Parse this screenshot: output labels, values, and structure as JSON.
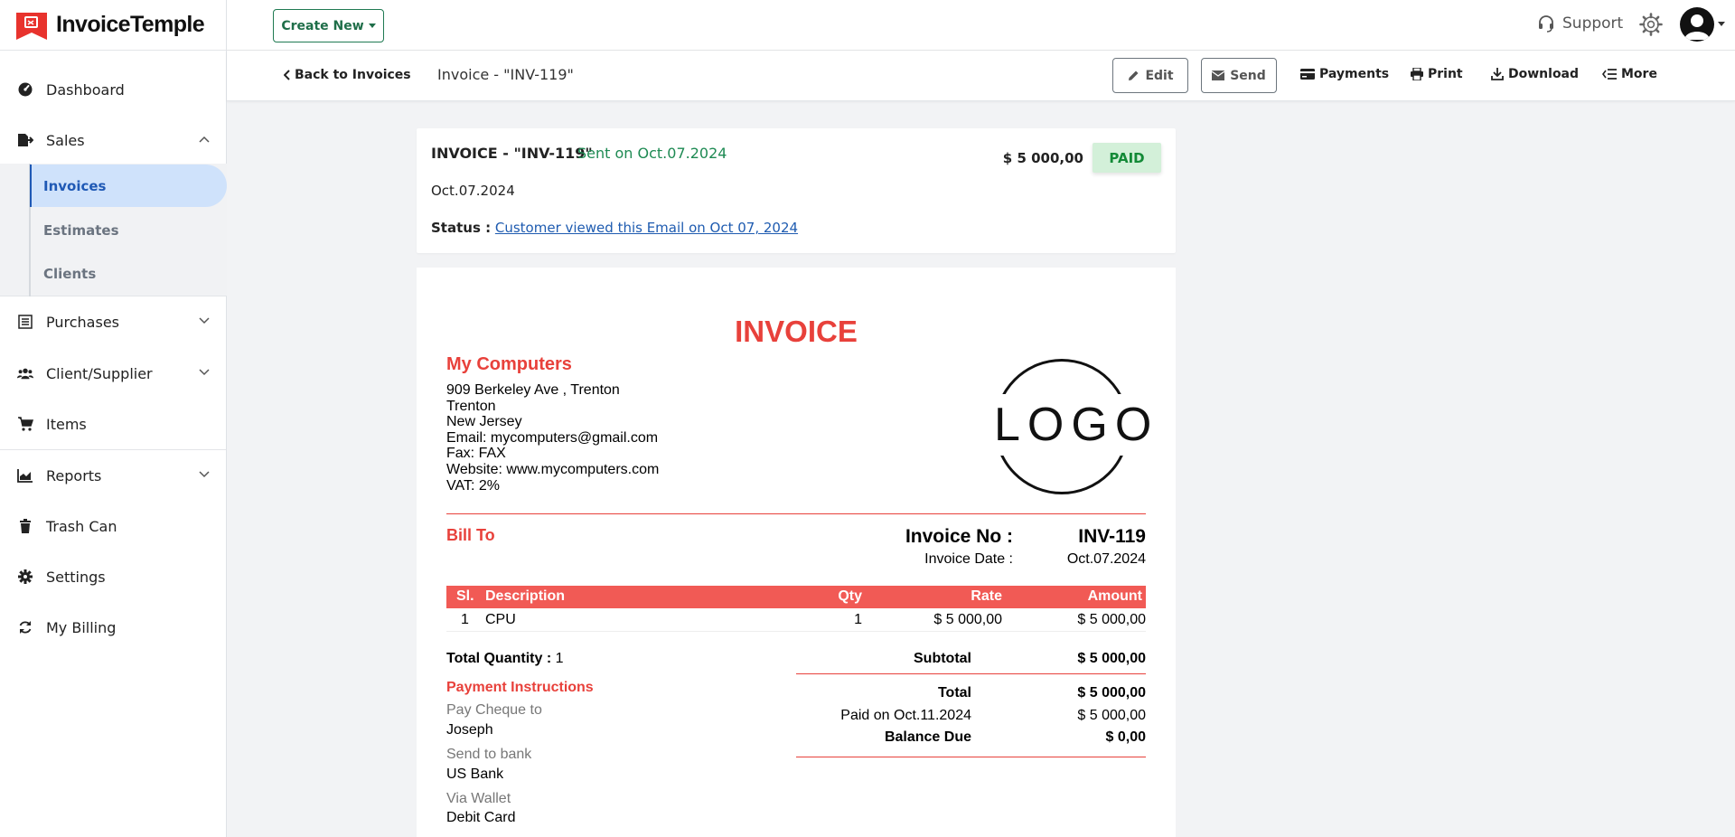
{
  "brand": {
    "name": "InvoiceTemple"
  },
  "sidebar": {
    "items": [
      {
        "label": "Dashboard",
        "icon": "dashboard-gauge-icon"
      },
      {
        "label": "Sales",
        "icon": "sales-file-icon",
        "expanded": true,
        "children": [
          {
            "label": "Invoices",
            "active": true
          },
          {
            "label": "Estimates"
          },
          {
            "label": "Clients"
          }
        ]
      },
      {
        "label": "Purchases",
        "icon": "purchases-list-icon"
      },
      {
        "label": "Client/Supplier",
        "icon": "users-icon"
      },
      {
        "label": "Items",
        "icon": "cart-icon"
      },
      {
        "label": "Reports",
        "icon": "chart-icon"
      },
      {
        "label": "Trash Can",
        "icon": "trash-icon"
      },
      {
        "label": "Settings",
        "icon": "gear-icon"
      },
      {
        "label": "My Billing",
        "icon": "refresh-icon"
      }
    ]
  },
  "topbar": {
    "create_new": "Create New",
    "support": "Support"
  },
  "subbar": {
    "back": "Back to Invoices",
    "title": "Invoice - \"INV-119\"",
    "actions": {
      "edit": "Edit",
      "send": "Send",
      "payments": "Payments",
      "print": "Print",
      "download": "Download",
      "more": "More"
    }
  },
  "summary": {
    "title": "INVOICE - \"INV-119\"",
    "sent": "Sent on Oct.07.2024",
    "amount": "$ 5 000,00",
    "badge": "PAID",
    "date": "Oct.07.2024",
    "status_label": "Status :",
    "status_text": "Customer viewed this Email on Oct 07, 2024"
  },
  "invoice": {
    "heading": "INVOICE",
    "company": {
      "name": "My Computers",
      "lines": [
        "909 Berkeley Ave , Trenton",
        "Trenton",
        "New Jersey",
        "Email: mycomputers@gmail.com",
        "Fax: FAX",
        "Website: www.mycomputers.com",
        "VAT: 2%"
      ]
    },
    "logo_text": "LOGO",
    "bill_to": "Bill To",
    "invoice_no_label": "Invoice No :",
    "invoice_no": "INV-119",
    "invoice_date_label": "Invoice Date :",
    "invoice_date": "Oct.07.2024",
    "columns": {
      "sl": "Sl.",
      "description": "Description",
      "qty": "Qty",
      "rate": "Rate",
      "amount": "Amount"
    },
    "rows": [
      {
        "sl": "1",
        "description": "CPU",
        "qty": "1",
        "rate": "$ 5 000,00",
        "amount": "$ 5 000,00"
      }
    ],
    "total_quantity_label": "Total Quantity :",
    "total_quantity": "1",
    "payment_instructions": {
      "title": "Payment Instructions",
      "items": [
        {
          "label": "Pay Cheque to",
          "value": "Joseph"
        },
        {
          "label": "Send to bank",
          "value": "US Bank"
        },
        {
          "label": "Via Wallet",
          "value": "Debit Card"
        }
      ]
    },
    "totals": {
      "subtotal_label": "Subtotal",
      "subtotal": "$ 5 000,00",
      "total_label": "Total",
      "total": "$ 5 000,00",
      "paid_label": "Paid on Oct.11.2024",
      "paid": "$ 5 000,00",
      "balance_label": "Balance Due",
      "balance": "$ 0,00"
    }
  },
  "colors": {
    "accent_red": "#e8413b",
    "table_head": "#f15a55",
    "green": "#1e8a53",
    "paid_bg": "#d3f0d9",
    "active_bg": "#cfe2fb",
    "link": "#1e5bb0"
  }
}
